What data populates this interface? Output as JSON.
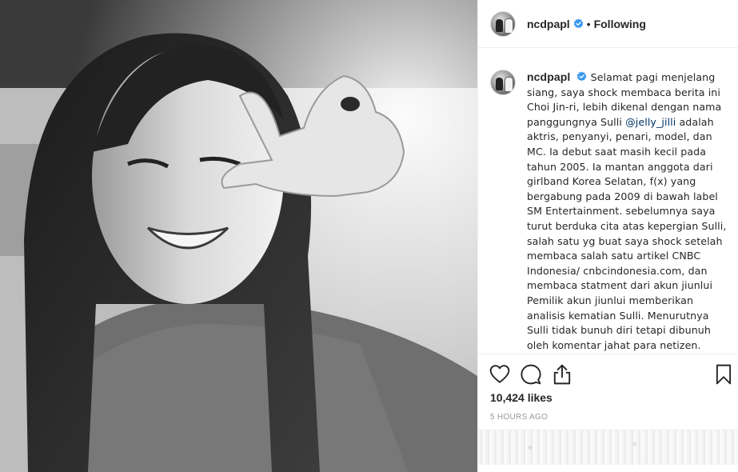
{
  "post": {
    "username": "ncdpapl",
    "follow_status": "Following",
    "separator": "•",
    "caption": {
      "username": "ncdpapl",
      "text_before_mention": "Selamat pagi menjelang siang, saya shock membaca berita ini Choi Jin-ri, lebih dikenal dengan nama panggungnya Sulli",
      "mention": "@jelly_jilli",
      "text_after_mention": "adalah aktris, penyanyi, penari, model, dan MC. Ia debut saat masih kecil pada tahun 2005. Ia mantan anggota dari girlband Korea Selatan, f(x) yang bergabung pada 2009 di bawah label SM Entertainment. sebelumnya saya turut berduka cita atas kepergian Sulli, salah satu yg buat saya shock setelah membaca salah satu artikel CNBC Indonesia/ cnbcindonesia.com, dan membaca statment dari akun jiunlui Pemilik akun jiunlui memberikan analisis kematian Sulli. Menurutnya Sulli tidak bunuh diri tetapi dibunuh oleh komentar jahat para netizen. Selama ini Sulli diserang secara"
    },
    "likes": "10,424 likes",
    "time_ago": "5 HOURS AGO"
  },
  "icons": {
    "like": "heart-icon",
    "comment": "comment-bubble-icon",
    "share": "share-icon",
    "save": "bookmark-icon",
    "verified": "verified-badge-icon"
  },
  "colors": {
    "text": "#262626",
    "verified": "#3897f0",
    "mention": "#003569",
    "muted": "#999999",
    "border": "#efefef"
  }
}
